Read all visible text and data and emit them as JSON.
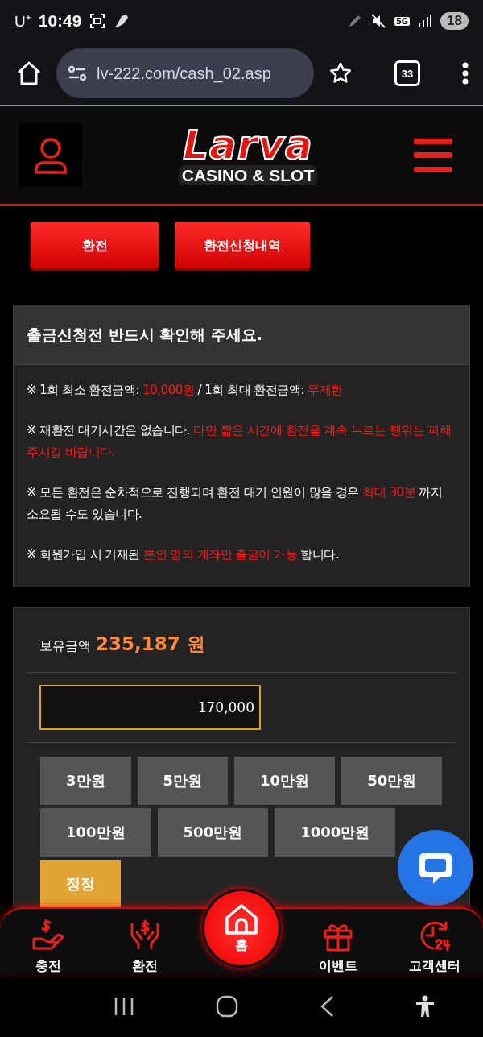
{
  "status_bar": {
    "carrier": "U⁺",
    "time": "10:49",
    "network": "5G",
    "battery": "18"
  },
  "browser": {
    "url": "lv-222.com/cash_02.asp",
    "tab_count": "33"
  },
  "header": {
    "logo_title": "Larva",
    "logo_subtitle": "CASINO & SLOT"
  },
  "tabs": [
    {
      "label": "환전",
      "selected": true
    },
    {
      "label": "환전신청내역",
      "selected": true
    }
  ],
  "notice": {
    "title": "출금신청전 반드시 확인해 주세요.",
    "lines": [
      [
        {
          "text": "※ 1회 최소 환전금액: ",
          "highlight": false
        },
        {
          "text": "10,000원",
          "highlight": true
        },
        {
          "text": " / 1회 최대 환전금액: ",
          "highlight": false
        },
        {
          "text": "무제한",
          "highlight": true
        }
      ],
      [
        {
          "text": "※ 재환전 대기시간은 없습니다. ",
          "highlight": false
        },
        {
          "text": "다만 짧은 시간에 환전을 계속 누르는 행위는 피해주시길 바랍니다.",
          "highlight": true
        }
      ],
      [
        {
          "text": "※ 모든 환전은 순차적으로 진행되며 환전 대기 인원이 많을 경우 ",
          "highlight": false
        },
        {
          "text": "최대 30분",
          "highlight": true
        },
        {
          "text": " 까지 소요될 수도 있습니다.",
          "highlight": false
        }
      ],
      [
        {
          "text": "※ 회원가입 시 기재된 ",
          "highlight": false
        },
        {
          "text": "본인 명의 계좌만 출금이 가능",
          "highlight": true
        },
        {
          "text": " 합니다.",
          "highlight": false
        }
      ]
    ]
  },
  "withdraw": {
    "balance_label": "보유금액",
    "balance_value": "235,187 원",
    "amount_value": "170,000",
    "amount_buttons": [
      {
        "label": "3만원",
        "kind": "amount"
      },
      {
        "label": "5만원",
        "kind": "amount"
      },
      {
        "label": "10만원",
        "kind": "amount"
      },
      {
        "label": "50만원",
        "kind": "amount"
      },
      {
        "label": "100만원",
        "kind": "amount"
      },
      {
        "label": "500만원",
        "kind": "amount"
      },
      {
        "label": "1000만원",
        "kind": "amount"
      },
      {
        "label": "정정",
        "kind": "reset"
      }
    ]
  },
  "bottom_nav": [
    {
      "label": "충전",
      "kind": "charge",
      "selected": false
    },
    {
      "label": "환전",
      "kind": "exchange",
      "selected": false
    },
    {
      "label": "홈",
      "kind": "home",
      "selected": true
    },
    {
      "label": "이벤트",
      "kind": "event",
      "selected": false
    },
    {
      "label": "고객센터",
      "kind": "support",
      "selected": false
    }
  ]
}
